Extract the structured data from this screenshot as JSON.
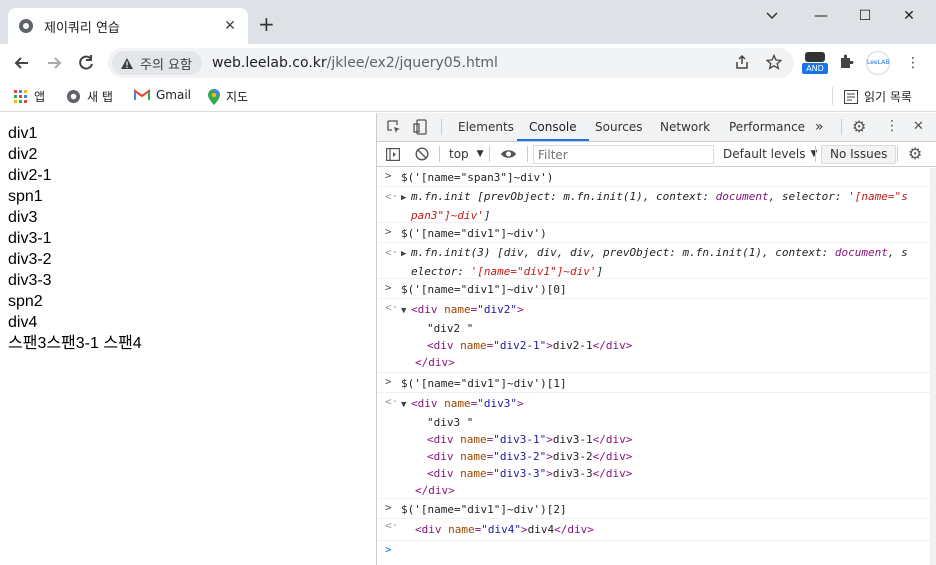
{
  "browser": {
    "tab_title": "제이쿼리 연습",
    "new_tab": "+",
    "security_chip": "주의 요함",
    "url_host": "web.leelab.co.kr",
    "url_path": "/jklee/ex2/jquery05.html",
    "profile_badge": "AND",
    "profile_text": "LeeLAB"
  },
  "bookmarks": {
    "apps": "앱",
    "newtab": "새 탭",
    "gmail": "Gmail",
    "maps": "지도",
    "reading_list": "읽기 목록"
  },
  "page": {
    "lines": [
      "div1",
      "div2",
      "div2-1",
      "spn1",
      "div3",
      "div3-1",
      "div3-2",
      "div3-3",
      "spn2",
      "div4",
      "스팬3스팬3-1 스팬4"
    ]
  },
  "devtools": {
    "tabs": [
      "Elements",
      "Console",
      "Sources",
      "Network",
      "Performance"
    ],
    "more": "»",
    "context": "top",
    "filter_placeholder": "Filter",
    "levels": "Default levels",
    "issues": "No Issues"
  },
  "console": {
    "c1": "$('[name=\"span3\"]~div')",
    "r1a_fn": "m.fn.init ",
    "r1a_rest": "[prevObject: ",
    "r1a_po": "m.fn.init(1)",
    "r1a_ctx": ", context: ",
    "r1a_doc": "document",
    "r1a_sel": ", selector: ",
    "r1a_str": "'[name=\"s",
    "r1b_str": "pan3\"]~div'",
    "r1b_end": "]",
    "c2": "$('[name=\"div1\"]~div')",
    "r2a_fn": "m.fn.init(3) ",
    "r2a_rest": "[div, div, div, prevObject: ",
    "r2a_po": "m.fn.init(1)",
    "r2a_ctx": ", context: ",
    "r2a_doc": "document",
    "r2a_tail": ", s",
    "r2b_sel": "elector: ",
    "r2b_str": "'[name=\"div1\"]~div'",
    "r2b_end": "]",
    "c3": "$('[name=\"div1\"]~div')[0]",
    "c4": "$('[name=\"div1\"]~div')[1]",
    "c5": "$('[name=\"div1\"]~div')[2]",
    "div_open": "<div",
    "name_attr": " name",
    "eq": "=",
    "gt": ">",
    "div_close": "</div>",
    "q_div2": "\"div2\"",
    "q_div21": "\"div2-1\"",
    "q_div3": "\"div3\"",
    "q_div31": "\"div3-1\"",
    "q_div32": "\"div3-2\"",
    "q_div33": "\"div3-3\"",
    "q_div4": "\"div4\"",
    "t_div2": "\"div2 \"",
    "t_div21": "div2-1",
    "t_div3": "\"div3 \"",
    "t_div31": "div3-1",
    "t_div32": "div3-2",
    "t_div33": "div3-3",
    "t_div4": "div4",
    "prompt": ">"
  }
}
